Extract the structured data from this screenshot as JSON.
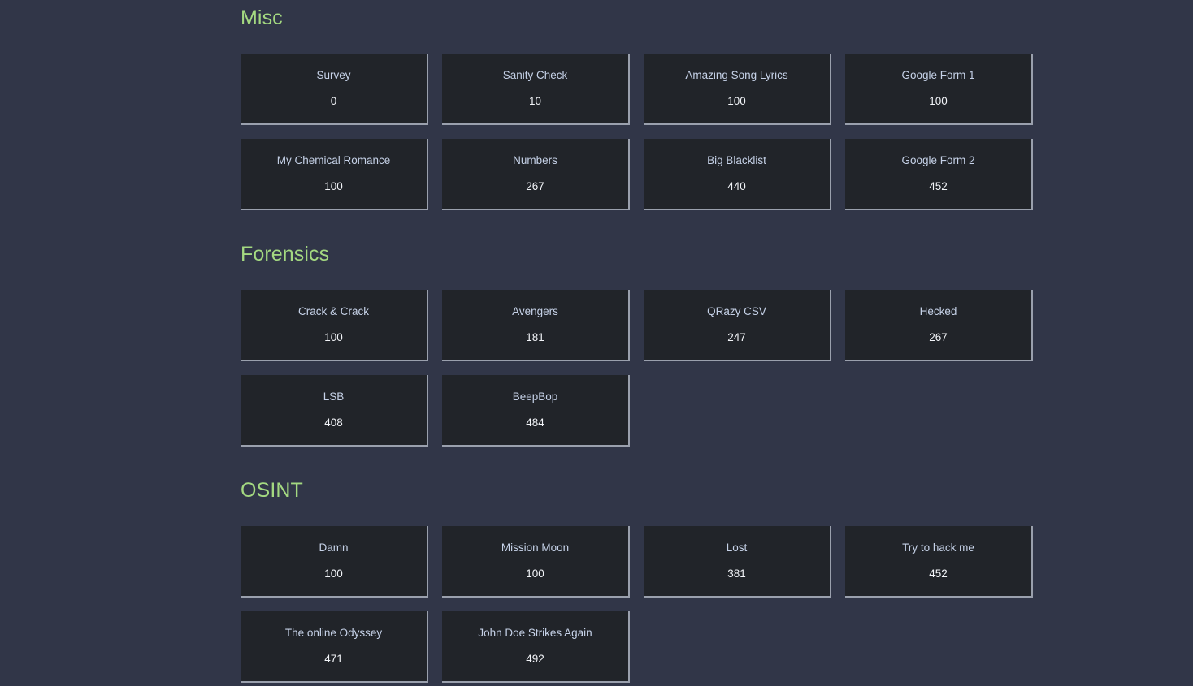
{
  "page": {
    "background_color": "#313648",
    "card_background_color": "#212429",
    "card_border_color": "#9aa0ad",
    "category_title_color": "#a4d981",
    "card_title_color": "#c6d2e8",
    "card_value_color": "#f2f4f8"
  },
  "categories": [
    {
      "name": "Misc",
      "challenges": [
        {
          "title": "Survey",
          "points": "0"
        },
        {
          "title": "Sanity Check",
          "points": "10"
        },
        {
          "title": "Amazing Song Lyrics",
          "points": "100"
        },
        {
          "title": "Google Form 1",
          "points": "100"
        },
        {
          "title": "My Chemical Romance",
          "points": "100"
        },
        {
          "title": "Numbers",
          "points": "267"
        },
        {
          "title": "Big Blacklist",
          "points": "440"
        },
        {
          "title": "Google Form 2",
          "points": "452"
        }
      ]
    },
    {
      "name": "Forensics",
      "challenges": [
        {
          "title": "Crack & Crack",
          "points": "100"
        },
        {
          "title": "Avengers",
          "points": "181"
        },
        {
          "title": "QRazy CSV",
          "points": "247"
        },
        {
          "title": "Hecked",
          "points": "267"
        },
        {
          "title": "LSB",
          "points": "408"
        },
        {
          "title": "BeepBop",
          "points": "484"
        }
      ]
    },
    {
      "name": "OSINT",
      "challenges": [
        {
          "title": "Damn",
          "points": "100"
        },
        {
          "title": "Mission Moon",
          "points": "100"
        },
        {
          "title": "Lost",
          "points": "381"
        },
        {
          "title": "Try to hack me",
          "points": "452"
        },
        {
          "title": "The online Odyssey",
          "points": "471"
        },
        {
          "title": "John Doe Strikes Again",
          "points": "492"
        }
      ]
    }
  ]
}
